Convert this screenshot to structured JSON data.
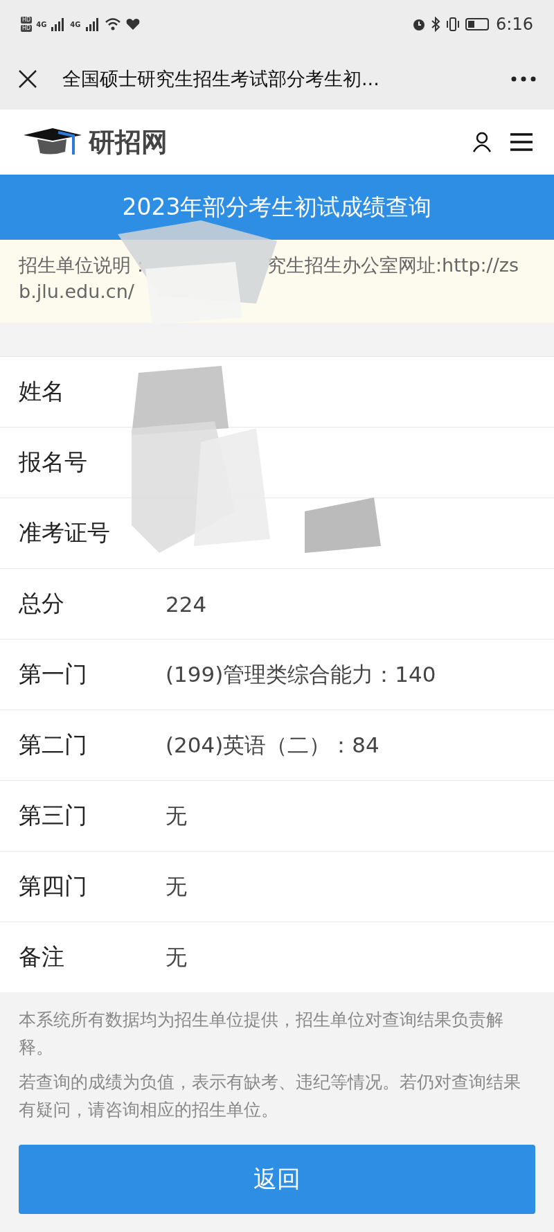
{
  "status_bar": {
    "hd_labels": [
      "HD",
      "HD"
    ],
    "network_labels": [
      "4G",
      "4G"
    ],
    "time": "6:16"
  },
  "nav_bar": {
    "title": "全国硕士研究生招生考试部分考生初..."
  },
  "site_header": {
    "logo_text": "研招网"
  },
  "banner": {
    "title": "2023年部分考生初试成绩查询"
  },
  "notice": {
    "visible_parts": [
      "招生单位说明：",
      "究生招生办公室网址:http://zsb.jlu.edu.cn/"
    ]
  },
  "result_rows": [
    {
      "label": "姓名"
    },
    {
      "label": "报名号"
    },
    {
      "label": "准考证号"
    },
    {
      "label": "总分",
      "value": "224"
    },
    {
      "label": "第一门",
      "value": "(199)管理类综合能力：140"
    },
    {
      "label": "第二门",
      "value": "(204)英语（二）：84"
    },
    {
      "label": "第三门",
      "value": "无"
    },
    {
      "label": "第四门",
      "value": "无"
    },
    {
      "label": "备注",
      "value": "无"
    }
  ],
  "footer_notes": [
    "本系统所有数据均为招生单位提供，招生单位对查询结果负责解释。",
    "若查询的成绩为负值，表示有缺考、违纪等情况。若仍对查询结果有疑问，请咨询相应的招生单位。"
  ],
  "back_button": {
    "label": "返回"
  }
}
